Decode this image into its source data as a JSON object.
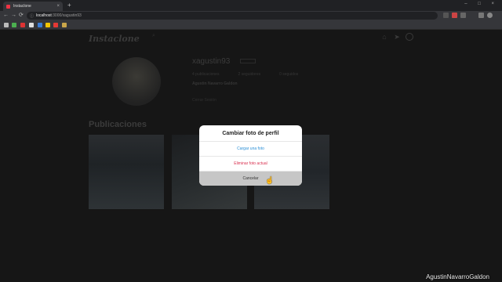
{
  "browser": {
    "tab_title": "Instaclone",
    "tab_close": "×",
    "new_tab": "+",
    "window_controls": "– □ ×",
    "url_host": "localhost",
    "url_path": ":3000/xagustin93",
    "back": "←",
    "forward": "→",
    "reload": "⟳"
  },
  "header": {
    "logo": "Instaclone",
    "search_icon": "⌕",
    "home_icon": "⌂",
    "send_icon": "➤"
  },
  "profile": {
    "username": "xagustin93",
    "stats": [
      "4 publicaciones",
      "2 seguidores",
      "0 seguidos"
    ],
    "full_name": "Agustin Navarro Galdon",
    "logout": "Cerrar Sesión"
  },
  "publications": {
    "title": "Publicaciones"
  },
  "modal": {
    "title": "Cambiar foto de perfil",
    "upload": "Cargar una foto",
    "delete": "Eliminar foto actual",
    "cancel": "Cancelar"
  },
  "watermark": "AgustinNavarroGaldon"
}
